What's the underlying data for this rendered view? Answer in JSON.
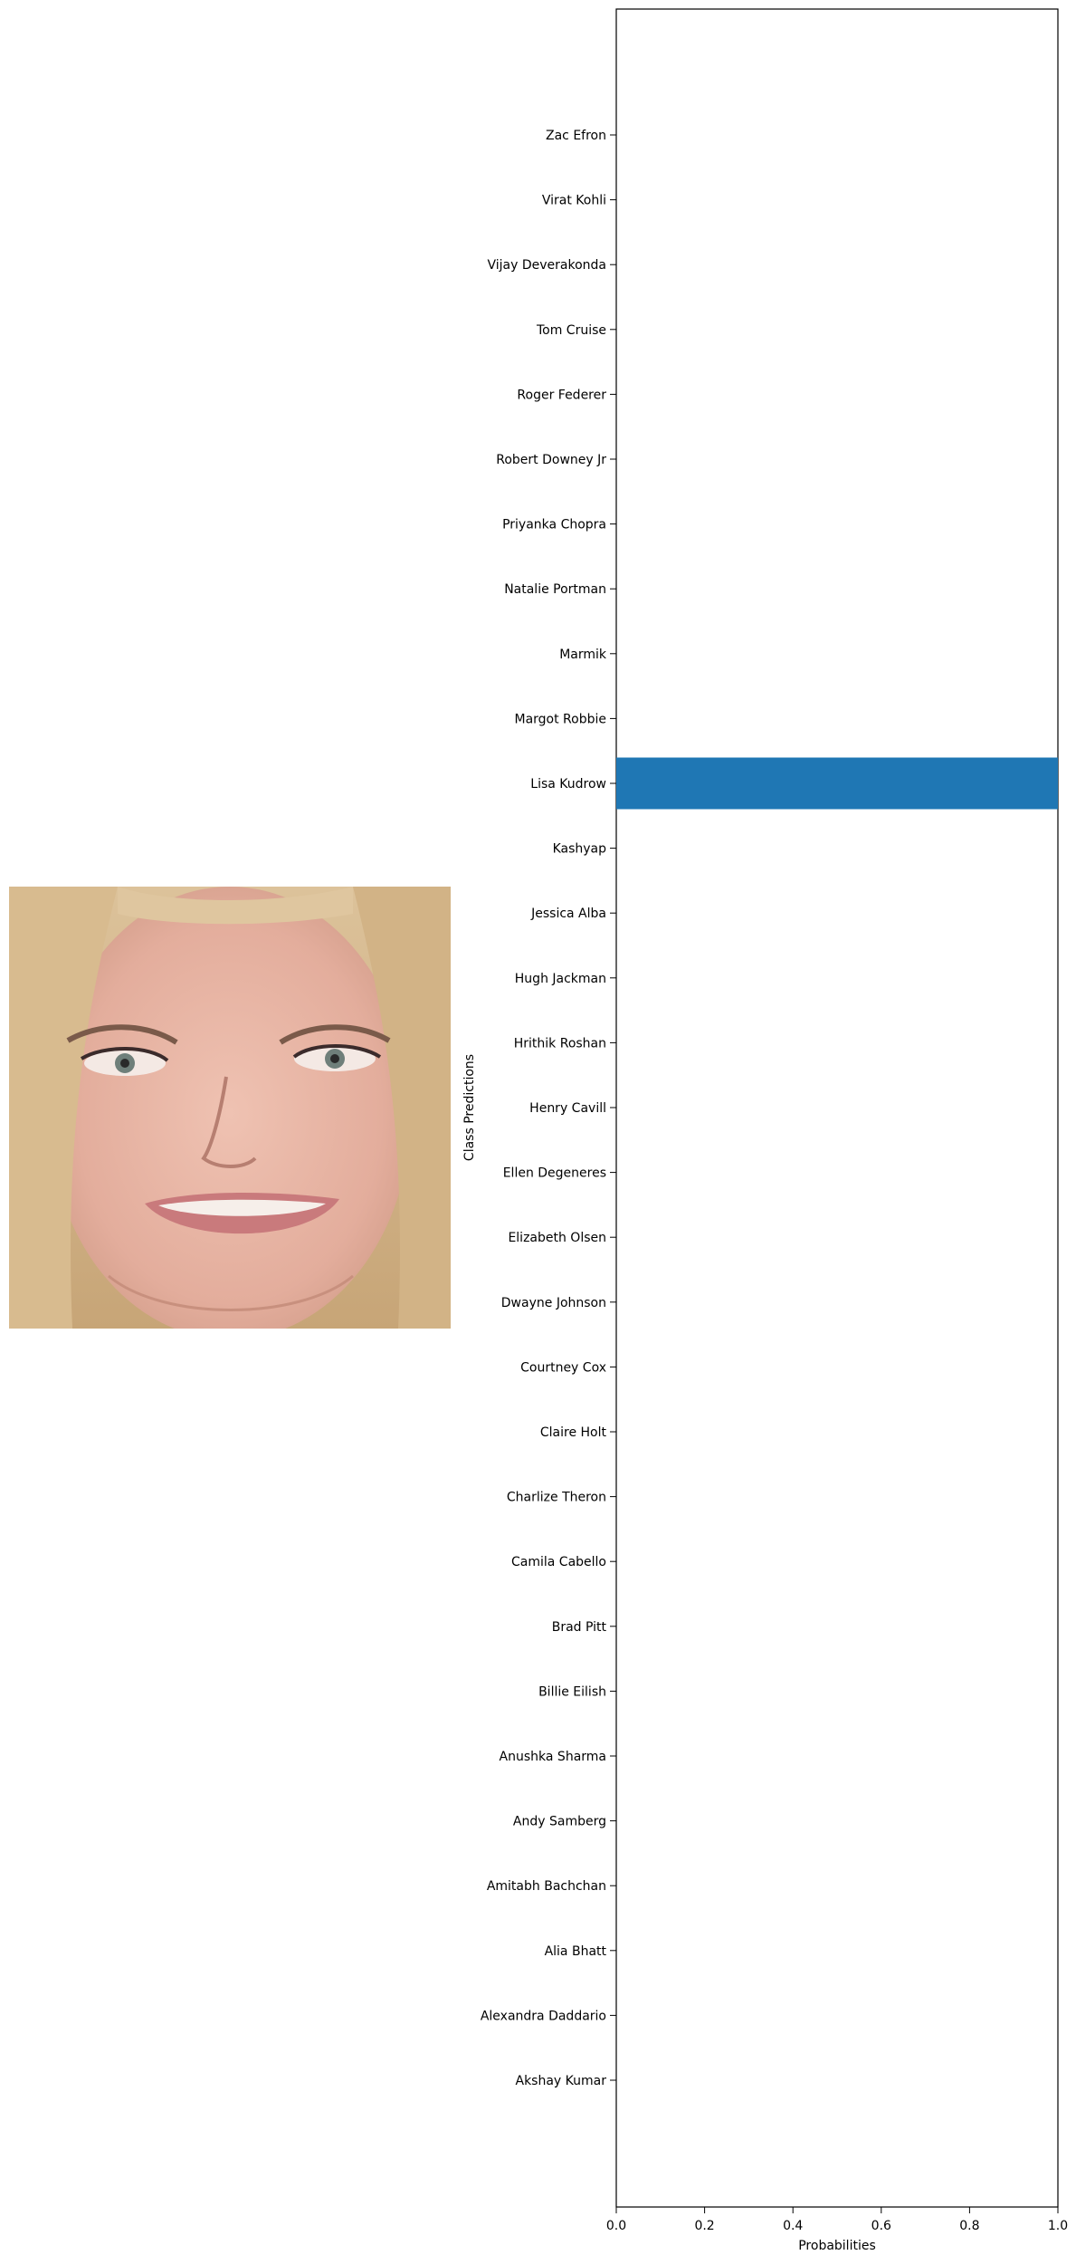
{
  "figure": {
    "image": {
      "description_icon": "portrait-photo",
      "colors": {
        "hair": "#d7b98a",
        "skin": "#e7b7a6",
        "background": "#c9a98f"
      }
    }
  },
  "chart_data": {
    "type": "bar",
    "orientation": "horizontal",
    "categories": [
      "Akshay Kumar",
      "Alexandra Daddario",
      "Alia Bhatt",
      "Amitabh Bachchan",
      "Andy Samberg",
      "Anushka Sharma",
      "Billie Eilish",
      "Brad Pitt",
      "Camila Cabello",
      "Charlize Theron",
      "Claire Holt",
      "Courtney Cox",
      "Dwayne Johnson",
      "Elizabeth Olsen",
      "Ellen Degeneres",
      "Henry Cavill",
      "Hrithik Roshan",
      "Hugh Jackman",
      "Jessica Alba",
      "Kashyap",
      "Lisa Kudrow",
      "Margot Robbie",
      "Marmik",
      "Natalie Portman",
      "Priyanka Chopra",
      "Robert Downey Jr",
      "Roger Federer",
      "Tom Cruise",
      "Vijay Deverakonda",
      "Virat Kohli",
      "Zac Efron"
    ],
    "values": [
      0,
      0,
      0,
      0,
      0,
      0,
      0,
      0,
      0,
      0,
      0,
      0,
      0,
      0,
      0,
      0,
      0,
      0,
      0,
      0,
      1.0,
      0,
      0,
      0,
      0,
      0,
      0,
      0,
      0,
      0,
      0
    ],
    "xlabel": "Probabilities",
    "ylabel": "Class Predictions",
    "xlim": [
      0,
      1.0
    ],
    "xticks": [
      "0.0",
      "0.2",
      "0.4",
      "0.6",
      "0.8",
      "1.0"
    ],
    "bar_color": "#1f77b4",
    "grid": false
  }
}
